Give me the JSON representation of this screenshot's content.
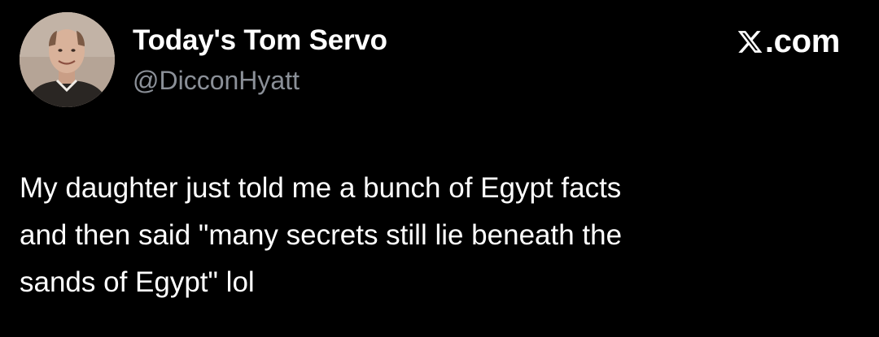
{
  "author": {
    "display_name": "Today's Tom Servo",
    "handle": "@DicconHyatt",
    "avatar_icon": "person-portrait-avatar"
  },
  "brand": {
    "icon": "x-logo-icon",
    "label": ".com"
  },
  "tweet": {
    "text": "My daughter just told me a bunch of Egypt facts\nand then said \"many secrets still lie beneath the\nsands of Egypt\" lol"
  },
  "colors": {
    "background": "#000000",
    "text": "#ffffff",
    "handle": "#8b9098"
  }
}
